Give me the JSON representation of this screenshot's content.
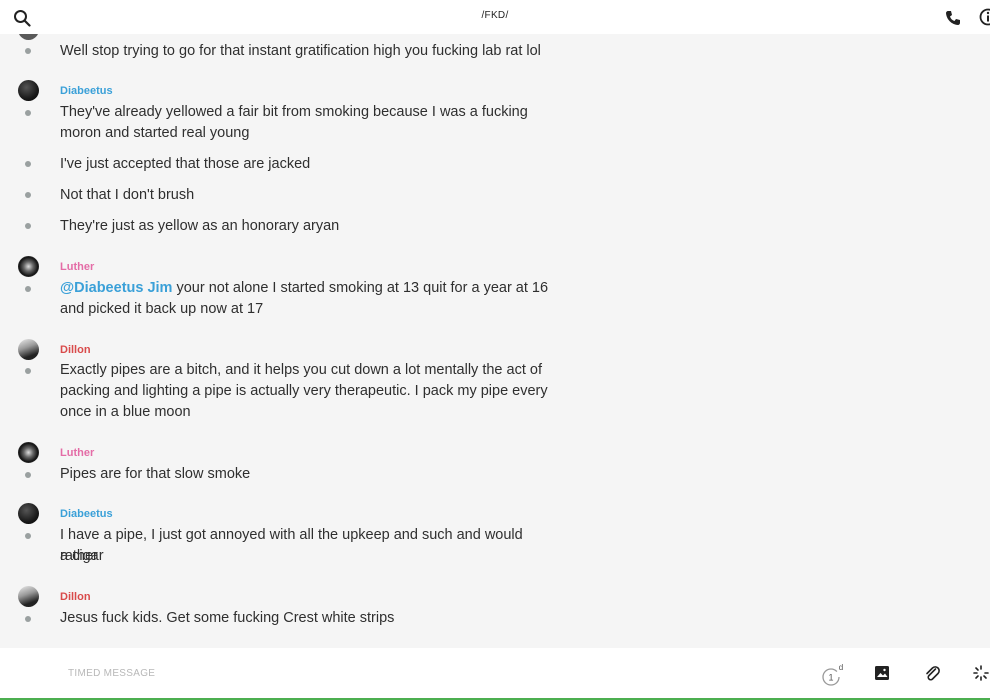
{
  "header": {
    "title": "/FKD/"
  },
  "colors": {
    "diabeetus": "#3aa0d8",
    "luther": "#e46ca6",
    "dillon": "#d94b4b",
    "accent": "#4caf50"
  },
  "messages": [
    {
      "lines": [
        "Well stop trying to go for that instant gratification high you fucking lab rat lol"
      ]
    },
    {
      "sender": "Diabeetus",
      "lines": [
        "They've already yellowed a fair bit from smoking because I was a fucking",
        "moron and started real young"
      ]
    },
    {
      "lines": [
        "I've just accepted that those are jacked"
      ]
    },
    {
      "lines": [
        "Not that I don't brush"
      ]
    },
    {
      "lines": [
        "They're just as yellow as an honorary aryan"
      ]
    },
    {
      "sender": "Luther",
      "mention": "@Diabeetus Jim",
      "lines": [
        " your not alone I started smoking at 13 quit for a year at 16",
        "and picked it back up now at 17"
      ]
    },
    {
      "sender": "Dillon",
      "lines": [
        "Exactly pipes are a bitch, and it helps you cut down a lot mentally the act of",
        "packing and lighting a pipe is actually very therapeutic. I pack my pipe every",
        "once in a blue moon"
      ]
    },
    {
      "sender": "Luther",
      "lines": [
        "Pipes are for that slow smoke"
      ]
    },
    {
      "sender": "Diabeetus",
      "lines": [
        "I have a pipe, I just got annoyed with all the upkeep and such and would rather",
        "a cigar"
      ]
    },
    {
      "sender": "Dillon",
      "lines": [
        "Jesus fuck kids. Get some fucking Crest white strips"
      ]
    }
  ],
  "composer": {
    "placeholder": "TIMED MESSAGE",
    "timer_value": "1",
    "timer_unit": "d"
  },
  "icons": [
    "search-icon",
    "phone-icon",
    "info-icon",
    "timer-icon",
    "image-icon",
    "paperclip-icon",
    "sparkle-icon"
  ]
}
